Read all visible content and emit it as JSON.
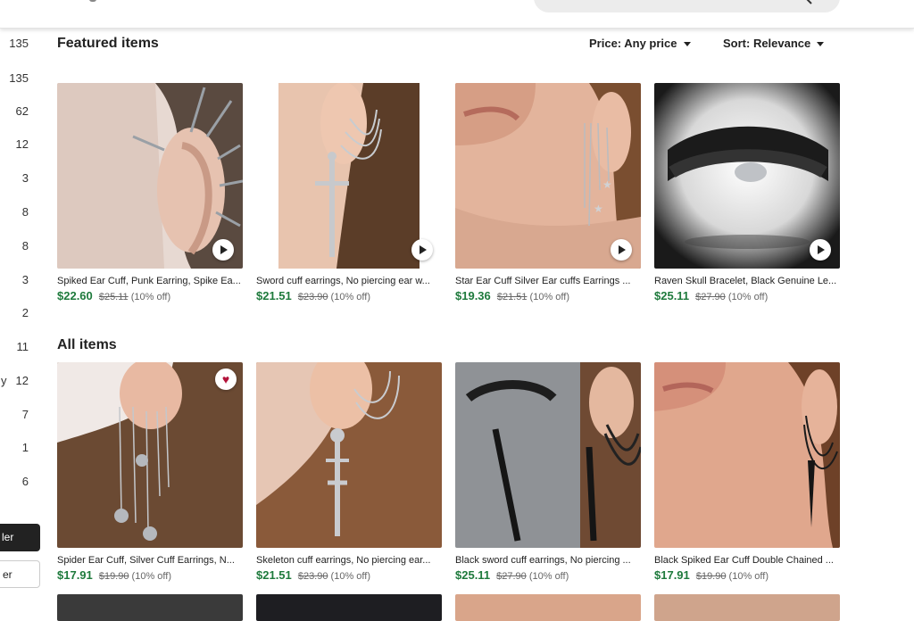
{
  "filters": {
    "counts": [
      "135",
      "135",
      "62",
      "12",
      "3",
      "8",
      "8",
      "3",
      "2",
      "11",
      "12",
      "7",
      "1",
      "6"
    ],
    "clipped_letter": "y",
    "dark_button": "ler",
    "light_button": "er"
  },
  "featured": {
    "title": "Featured items",
    "price_filter": "Price: Any price",
    "sort": "Sort: Relevance",
    "items": [
      {
        "title": "Spiked Ear Cuff, Punk Earring, Spike Ea...",
        "price": "$22.60",
        "original": "$25.11",
        "discount": "(10% off)"
      },
      {
        "title": "Sword cuff earrings, No piercing ear w...",
        "price": "$21.51",
        "original": "$23.90",
        "discount": "(10% off)"
      },
      {
        "title": "Star Ear Cuff Silver Ear cuffs Earrings ...",
        "price": "$19.36",
        "original": "$21.51",
        "discount": "(10% off)"
      },
      {
        "title": "Raven Skull Bracelet, Black Genuine Le...",
        "price": "$25.11",
        "original": "$27.90",
        "discount": "(10% off)"
      }
    ]
  },
  "all": {
    "title": "All items",
    "items": [
      {
        "title": "Spider Ear Cuff, Silver Cuff Earrings, N...",
        "price": "$17.91",
        "original": "$19.90",
        "discount": "(10% off)"
      },
      {
        "title": "Skeleton cuff earrings, No piercing ear...",
        "price": "$21.51",
        "original": "$23.90",
        "discount": "(10% off)"
      },
      {
        "title": "Black sword cuff earrings, No piercing ...",
        "price": "$25.11",
        "original": "$27.90",
        "discount": "(10% off)"
      },
      {
        "title": "Black Spiked Ear Cuff Double Chained ...",
        "price": "$17.91",
        "original": "$19.90",
        "discount": "(10% off)"
      }
    ]
  },
  "colors": {
    "price_green": "#1e7a3c",
    "favorite_red": "#b3123a"
  }
}
